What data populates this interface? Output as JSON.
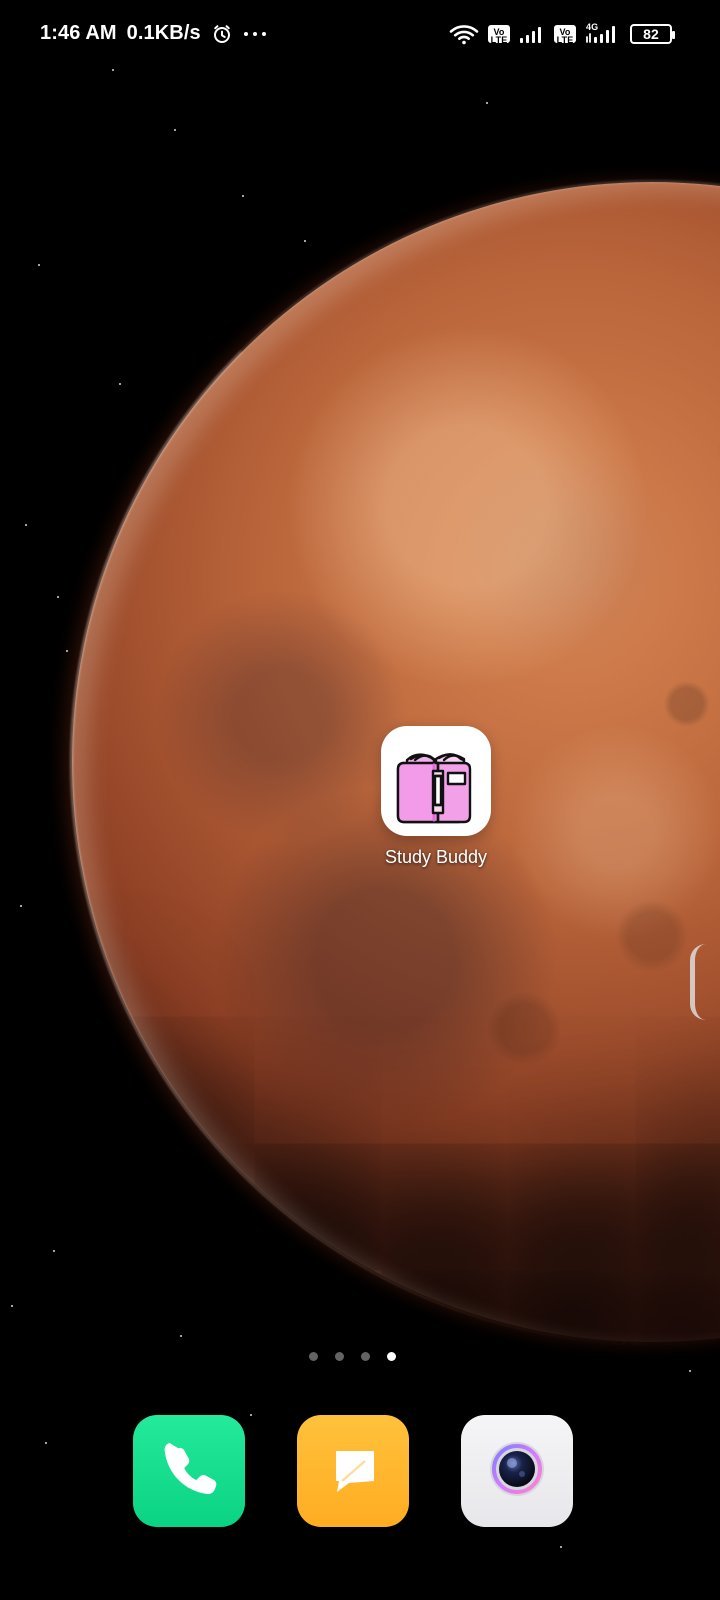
{
  "status_bar": {
    "time": "1:46 AM",
    "network_speed": "0.1KB/s",
    "alarm_icon": "alarm-clock-icon",
    "more_icon": "more-dots-icon",
    "wifi_icon": "wifi-icon",
    "volte_sim1_icon": "volte-icon",
    "signal_sim1_icon": "cellular-signal-icon",
    "volte_sim2_icon": "volte-icon",
    "network_type": "4G",
    "signal_sim2_icon": "cellular-signal-icon",
    "battery_level": "82"
  },
  "home": {
    "wallpaper_subject": "planet-wallpaper",
    "apps": [
      {
        "label": "Study Buddy",
        "icon": "book-icon"
      }
    ],
    "page_indicator": {
      "pages": 4,
      "active_page": 4
    }
  },
  "dock": {
    "apps": [
      {
        "icon": "phone-icon",
        "color": "#12DD8E"
      },
      {
        "icon": "messages-icon",
        "color": "#FFB52C"
      },
      {
        "icon": "camera-icon",
        "color": "#EEEEF2"
      }
    ]
  },
  "colors": {
    "accent_pink": "#F0A3E6",
    "accent_pink_dark": "#E06FD5",
    "book_outline": "#111111",
    "label_text": "#FFFFFF"
  }
}
